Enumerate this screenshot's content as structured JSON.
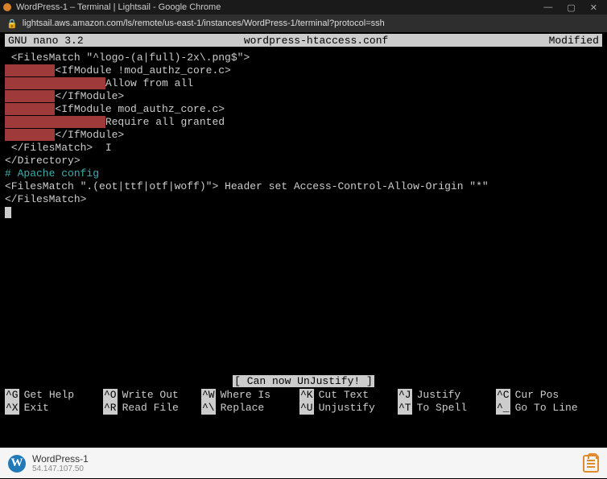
{
  "window": {
    "title": "WordPress-1 – Terminal | Lightsail - Google Chrome"
  },
  "address": {
    "url": "lightsail.aws.amazon.com/ls/remote/us-east-1/instances/WordPress-1/terminal?protocol=ssh"
  },
  "nano": {
    "version": "GNU nano 3.2",
    "filename": "wordpress-htaccess.conf",
    "status": "Modified",
    "message": "[ Can now UnJustify! ]"
  },
  "editor_lines": [
    {
      "text": " <FilesMatch \"^logo-(a|full)-2x\\.png$\">",
      "highlight": false
    },
    {
      "text": "        <IfModule !mod_authz_core.c>",
      "highlight": true,
      "hl_len": 8
    },
    {
      "text": "                Allow from all",
      "highlight": true,
      "hl_len": 16
    },
    {
      "text": "        </IfModule>",
      "highlight": true,
      "hl_len": 8
    },
    {
      "text": "",
      "highlight": false
    },
    {
      "text": "        <IfModule mod_authz_core.c>",
      "highlight": true,
      "hl_len": 8
    },
    {
      "text": "                Require all granted",
      "highlight": true,
      "hl_len": 16
    },
    {
      "text": "        </IfModule>",
      "highlight": true,
      "hl_len": 8
    },
    {
      "text": " </FilesMatch>",
      "highlight": false,
      "cursor": true
    },
    {
      "text": "</Directory>",
      "highlight": false
    },
    {
      "text": "",
      "highlight": false
    },
    {
      "text": "# Apache config",
      "highlight": false,
      "comment": true
    },
    {
      "text": "<FilesMatch \".(eot|ttf|otf|woff)\"> Header set Access-Control-Allow-Origin \"*\"",
      "highlight": false
    },
    {
      "text": "</FilesMatch>",
      "highlight": false
    }
  ],
  "shortcuts": {
    "row1": [
      {
        "key": "^G",
        "label": "Get Help"
      },
      {
        "key": "^O",
        "label": "Write Out"
      },
      {
        "key": "^W",
        "label": "Where Is"
      },
      {
        "key": "^K",
        "label": "Cut Text"
      },
      {
        "key": "^J",
        "label": "Justify"
      },
      {
        "key": "^C",
        "label": "Cur Pos"
      }
    ],
    "row2": [
      {
        "key": "^X",
        "label": "Exit"
      },
      {
        "key": "^R",
        "label": "Read File"
      },
      {
        "key": "^\\",
        "label": "Replace"
      },
      {
        "key": "^U",
        "label": "Unjustify"
      },
      {
        "key": "^T",
        "label": "To Spell"
      },
      {
        "key": "^_",
        "label": "Go To Line"
      }
    ]
  },
  "instance": {
    "name": "WordPress-1",
    "ip": "54.147.107.50"
  }
}
